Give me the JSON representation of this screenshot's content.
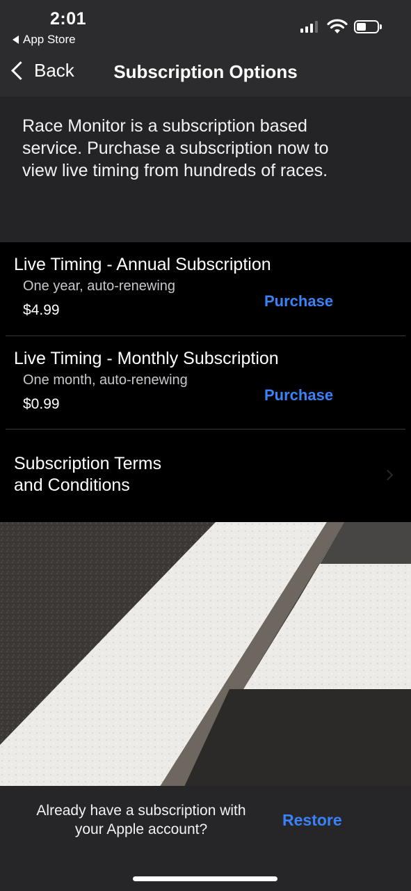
{
  "status_bar": {
    "time": "2:01",
    "back_app": "App Store"
  },
  "nav": {
    "back_label": "Back",
    "title": "Subscription Options"
  },
  "intro": {
    "text": "Race Monitor is a subscription based service.  Purchase a subscription now to view live timing from hundreds of races."
  },
  "options": [
    {
      "name": "Live Timing - Annual Subscription",
      "description": "One year, auto-renewing",
      "price": "$4.99",
      "action": "Purchase"
    },
    {
      "name": "Live Timing - Monthly Subscription",
      "description": "One month, auto-renewing",
      "price": "$0.99",
      "action": "Purchase"
    }
  ],
  "terms": {
    "label": "Subscription Terms and Conditions"
  },
  "footer": {
    "question": "Already have a subscription with your Apple account?",
    "restore": "Restore"
  },
  "colors": {
    "accent": "#3a82f7",
    "nav_bg": "#2c2c2e",
    "list_bg": "#000000"
  }
}
